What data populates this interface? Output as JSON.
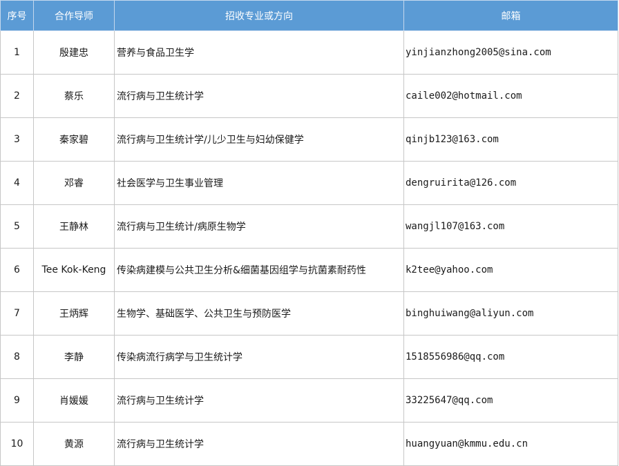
{
  "table": {
    "headers": {
      "no": "序号",
      "advisor": "合作导师",
      "major": "招收专业或方向",
      "email": "邮箱"
    },
    "rows": [
      {
        "no": "1",
        "advisor": "殷建忠",
        "major": "营养与食品卫生学",
        "email": "yinjianzhong2005@sina.com"
      },
      {
        "no": "2",
        "advisor": "蔡乐",
        "major": "流行病与卫生统计学",
        "email": "caile002@hotmail.com"
      },
      {
        "no": "3",
        "advisor": "秦家碧",
        "major": "流行病与卫生统计学/儿少卫生与妇幼保健学",
        "email": "qinjb123@163.com"
      },
      {
        "no": "4",
        "advisor": "邓睿",
        "major": "社会医学与卫生事业管理",
        "email": "dengruirita@126.com"
      },
      {
        "no": "5",
        "advisor": "王静林",
        "major": "流行病与卫生统计/病原生物学",
        "email": "wangjl107@163.com"
      },
      {
        "no": "6",
        "advisor": "Tee Kok-Keng",
        "major": "传染病建模与公共卫生分析&细菌基因组学与抗菌素耐药性",
        "email": "k2tee@yahoo.com"
      },
      {
        "no": "7",
        "advisor": "王炳辉",
        "major": "生物学、基础医学、公共卫生与预防医学",
        "email": "binghuiwang@aliyun.com"
      },
      {
        "no": "8",
        "advisor": "李静",
        "major": "传染病流行病学与卫生统计学",
        "email": "1518556986@qq.com"
      },
      {
        "no": "9",
        "advisor": "肖媛媛",
        "major": "流行病与卫生统计学",
        "email": "33225647@qq.com"
      },
      {
        "no": "10",
        "advisor": "黄源",
        "major": "流行病与卫生统计学",
        "email": "huangyuan@kmmu.edu.cn"
      }
    ]
  }
}
